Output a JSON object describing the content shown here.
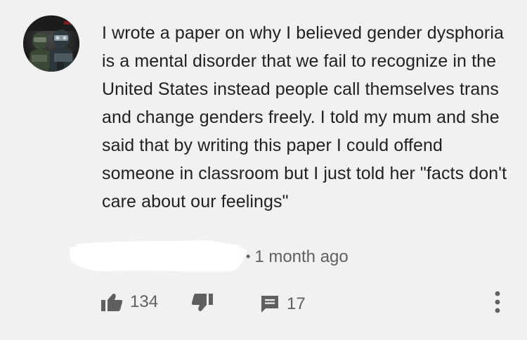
{
  "comment": {
    "avatar_icon": "user-avatar",
    "text": "I wrote a paper on why I believed gender dysphoria is a mental disorder that we fail to recognize in the United States instead people call themselves trans and change genders freely. I told my mum and she said that by writing this paper I could offend someone in classroom but I just told her \"facts don't care about our feelings\"",
    "author_redacted": true,
    "timestamp": "1 month ago",
    "separator": "•"
  },
  "actions": {
    "like_icon": "thumbs-up-icon",
    "like_count": "134",
    "dislike_icon": "thumbs-down-icon",
    "reply_icon": "comment-icon",
    "reply_count": "17",
    "more_icon": "more-vertical-icon"
  },
  "colors": {
    "background": "#f1f1f1",
    "text": "#212121",
    "secondary_text": "#606060",
    "icon": "#5f5f5f"
  }
}
